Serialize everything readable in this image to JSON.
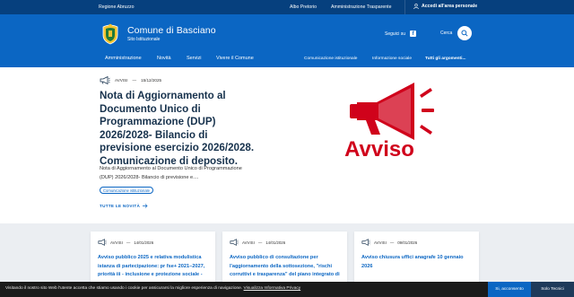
{
  "topbar": {
    "region": "Regione Abruzzo",
    "link1": "Albo Pretorio",
    "link2": "Amministrazione Trasparente",
    "login": "Accedi all'area personale"
  },
  "header": {
    "title": "Comune di Basciano",
    "subtitle": "Sito Istituzionale",
    "social_label": "Seguici su",
    "search_label": "Cerca"
  },
  "nav": {
    "items": [
      "Amministrazione",
      "Novità",
      "Servizi",
      "Vivere il Comune"
    ],
    "sub_items": [
      "Comunicazione istituzionale",
      "Informazione sociale",
      "Tutti gli argomenti..."
    ]
  },
  "hero": {
    "category": "AVVISI",
    "sep": "—",
    "date": "15/12/2025",
    "title": "Nota di Aggiornamento al Documento Unico di Programmazione (DUP) 2026/2028- Bilancio di previsione esercizio 2026/2028. Comunicazione di deposito.",
    "description": "Nota di Aggiornamento al Documento Unico di Programmazione (DUP) 2026/2028- Bilancio di previsione e....",
    "tag": "Comunicazione istituzionale",
    "all_news": "TUTTE LE NOVITÀ",
    "image_text": "Avviso"
  },
  "cards": [
    {
      "category": "AVVISI",
      "sep": "—",
      "date": "14/01/2026",
      "title": "Avviso pubblico 2025 e relativa modulistica istanza di partecipazione: pr fse+ 2021–2027, priorità iii - inclusione e protezione sociale -"
    },
    {
      "category": "AVVISI",
      "sep": "—",
      "date": "14/01/2026",
      "title": "Avviso pubblico di consultazione per l'aggiornamento della sottosezione, \"rischi corruttivi e trasparenza\" del piano integrato di"
    },
    {
      "category": "AVVISI",
      "sep": "—",
      "date": "09/01/2026",
      "title": "Avviso chiusura uffici anagrafe 10 gennaio 2026"
    }
  ],
  "cookie": {
    "message": "Visitando il nostro sito Web l'utente accetta che stiamo usando i cookie per assicurarsi la migliore esperienza di navigazione.",
    "policy_link": "Visualizza Informativa Privacy",
    "accept": "Si, acconsento",
    "tech_only": "Solo Tecnici"
  },
  "colors": {
    "topbar": "#06407e",
    "header": "#0b66c3",
    "title": "#17324d",
    "avviso_red": "#d0021b"
  }
}
